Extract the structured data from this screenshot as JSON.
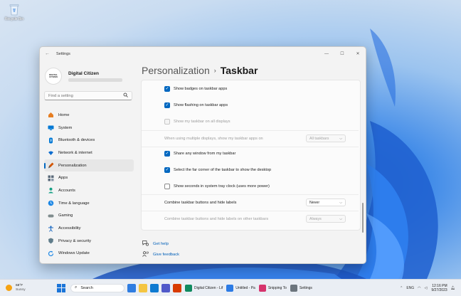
{
  "desktop": {
    "recycle_bin_label": "Recycle Bin"
  },
  "window": {
    "title": "Settings",
    "back_glyph": "←",
    "controls": {
      "minimize": "—",
      "maximize": "☐",
      "close": "✕"
    }
  },
  "profile": {
    "name": "Digital Citizen",
    "avatar_text": "DIGITAL CITIZEN"
  },
  "search": {
    "placeholder": "Find a setting"
  },
  "nav": [
    {
      "label": "Home",
      "icon": "home-icon",
      "color": "#d35400"
    },
    {
      "label": "System",
      "icon": "monitor-icon",
      "color": "#0078d4"
    },
    {
      "label": "Bluetooth & devices",
      "icon": "bluetooth-icon",
      "color": "#0078d4"
    },
    {
      "label": "Network & internet",
      "icon": "wifi-icon",
      "color": "#0a6ccf"
    },
    {
      "label": "Personalization",
      "icon": "brush-icon",
      "color": "#c0392b",
      "active": true
    },
    {
      "label": "Apps",
      "icon": "apps-icon",
      "color": "#5a6a7a"
    },
    {
      "label": "Accounts",
      "icon": "person-icon",
      "color": "#16a085"
    },
    {
      "label": "Time & language",
      "icon": "globe-clock-icon",
      "color": "#1e88e5"
    },
    {
      "label": "Gaming",
      "icon": "controller-icon",
      "color": "#7f8c8d"
    },
    {
      "label": "Accessibility",
      "icon": "accessibility-icon",
      "color": "#1565c0"
    },
    {
      "label": "Privacy & security",
      "icon": "shield-icon",
      "color": "#607d8b"
    },
    {
      "label": "Windows Update",
      "icon": "update-icon",
      "color": "#1e88e5"
    }
  ],
  "page": {
    "breadcrumb": "Personalization",
    "separator": "›",
    "title": "Taskbar"
  },
  "settings": {
    "show_badges": {
      "label": "Show badges on taskbar apps",
      "checked": true
    },
    "show_flashing": {
      "label": "Show flashing on taskbar apps",
      "checked": true
    },
    "all_displays": {
      "label": "Show my taskbar on all displays",
      "checked": false,
      "disabled": true
    },
    "multi_display": {
      "label": "When using multiple displays, show my taskbar apps on",
      "value": "All taskbars",
      "disabled": true
    },
    "share_window": {
      "label": "Share any window from my taskbar",
      "checked": true
    },
    "far_corner": {
      "label": "Select the far corner of the taskbar to show the desktop",
      "checked": true
    },
    "show_seconds": {
      "label": "Show seconds in system tray clock (uses more power)",
      "checked": false
    },
    "combine": {
      "label": "Combine taskbar buttons and hide labels",
      "value": "Never"
    },
    "combine_other": {
      "label": "Combine taskbar buttons and hide labels on other taskbars",
      "value": "Always",
      "disabled": true
    }
  },
  "links": {
    "help": "Get help",
    "feedback": "Give feedback"
  },
  "taskbar": {
    "weather_temp": "68°F",
    "weather_cond": "Sunny",
    "search_label": "Search",
    "tasks": [
      {
        "label": "Digital Citizen - Lif",
        "color": "#0f8a5f"
      },
      {
        "label": "Untitled - Pa",
        "color": "#2c7be5"
      },
      {
        "label": "Snipping To",
        "color": "#d6336c"
      },
      {
        "label": "Settings",
        "color": "#6c757d"
      }
    ],
    "lang": "ENG",
    "time": "12:16 PM",
    "date": "9/27/2023"
  }
}
